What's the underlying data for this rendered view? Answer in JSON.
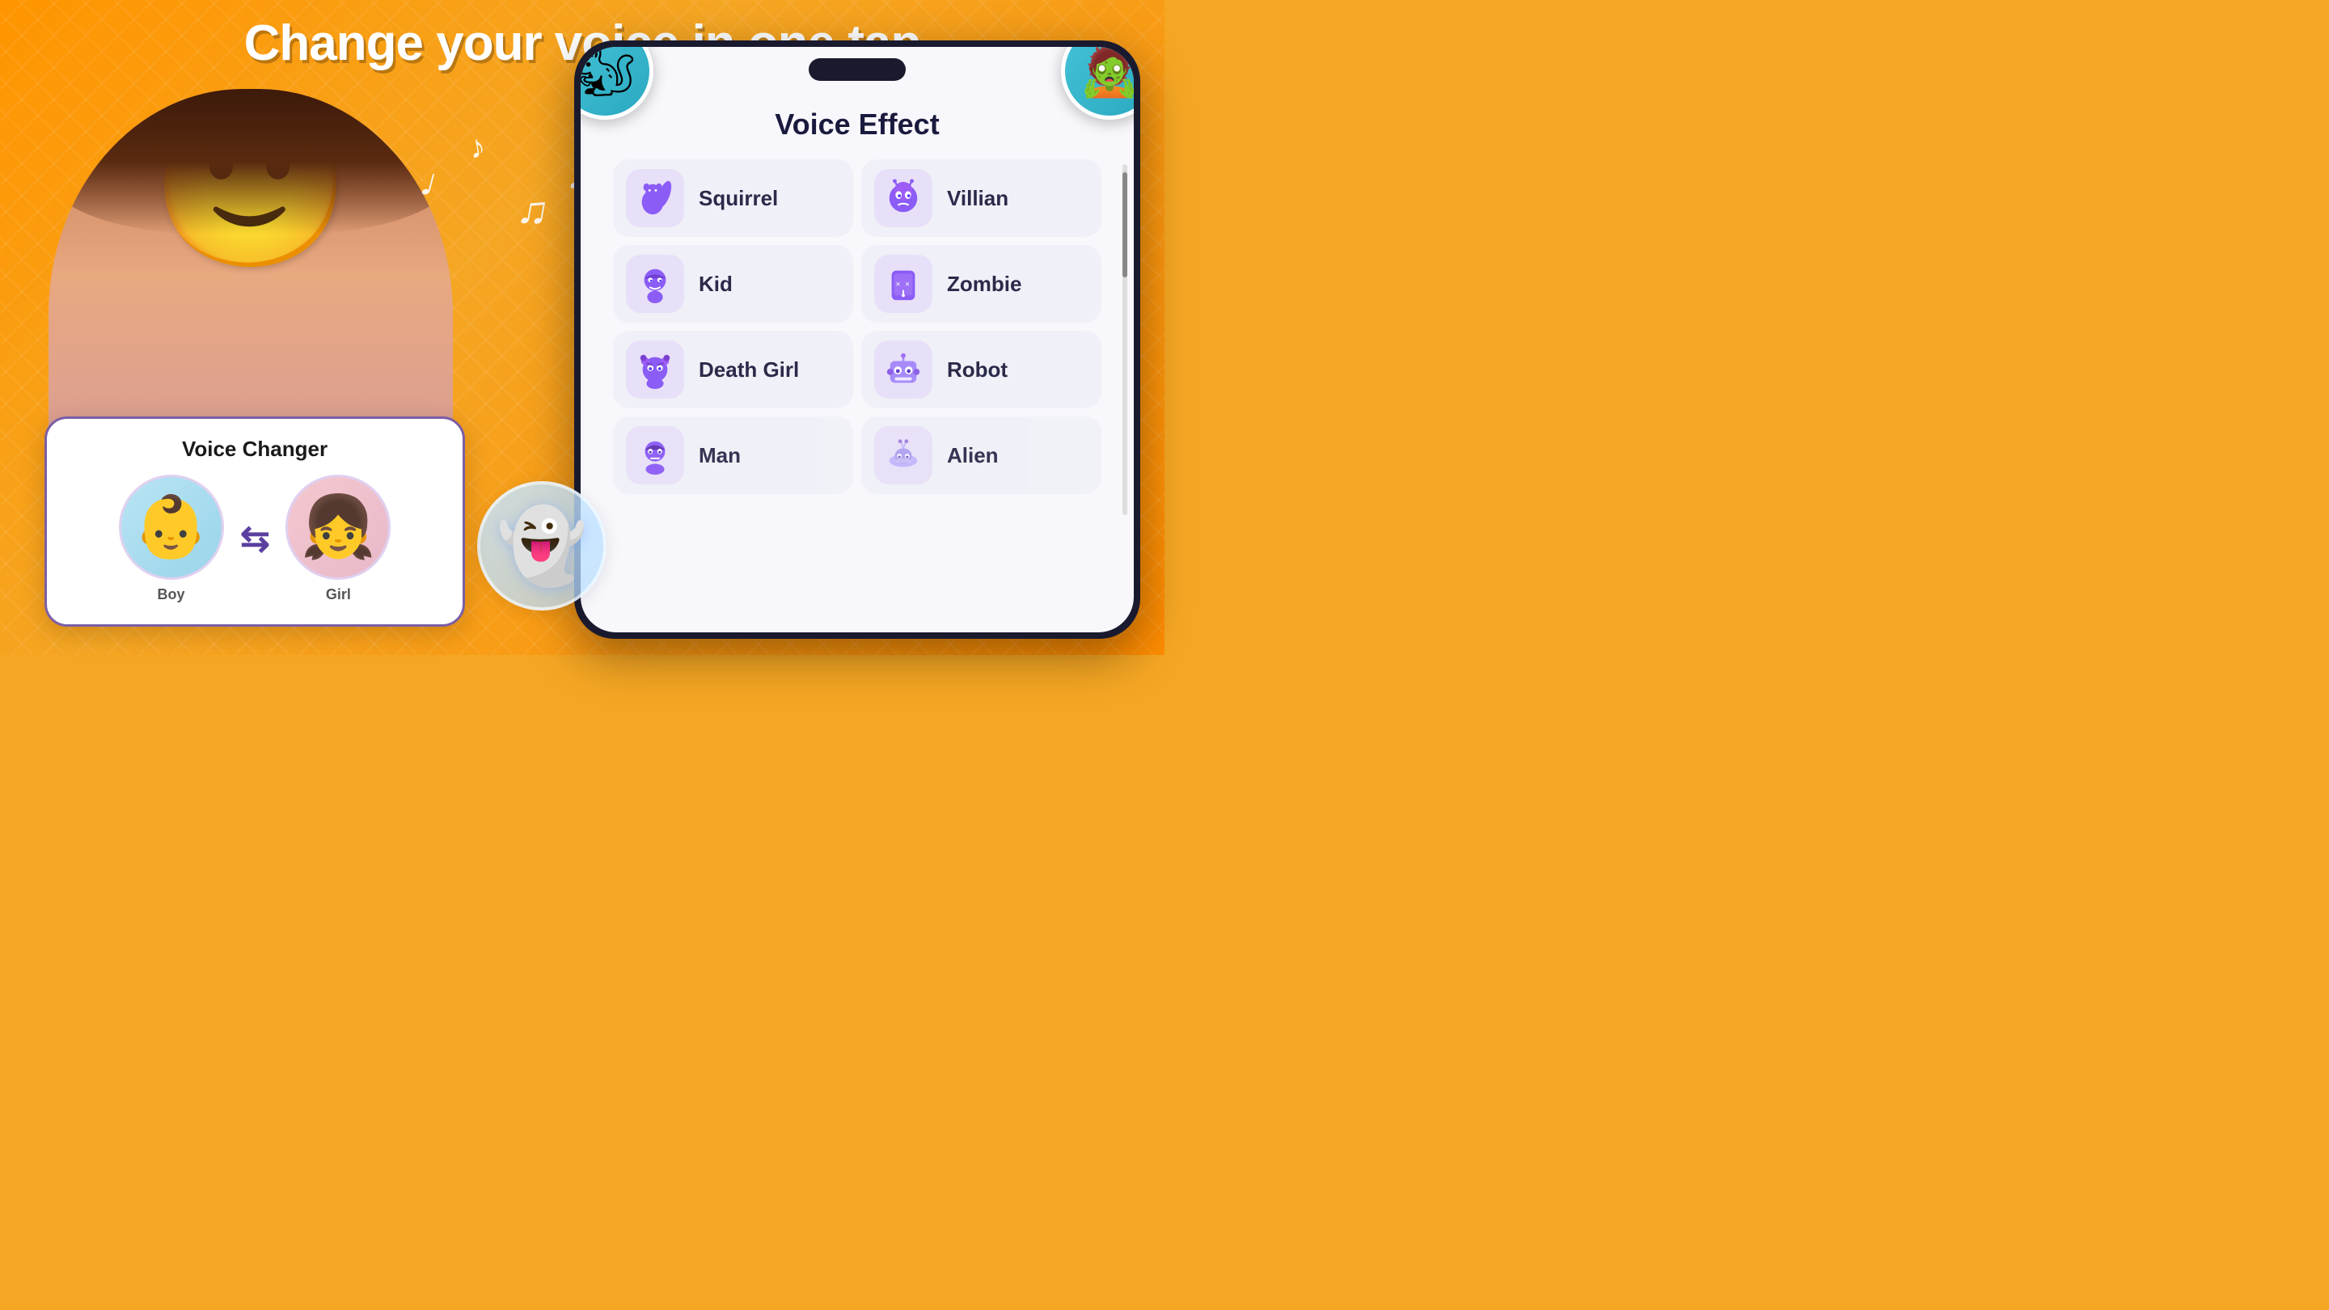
{
  "headline": "Change your voice in one tap",
  "colors": {
    "orange": "#F5A623",
    "purple": "#7B5EA7",
    "white": "#FFFFFF",
    "dark": "#1a1a2e"
  },
  "voiceChanger": {
    "title": "Voice Changer",
    "boy_label": "Boy",
    "girl_label": "Girl",
    "arrow": "↩"
  },
  "voiceEffect": {
    "title": "Voice Effect",
    "effects": [
      {
        "id": "squirrel",
        "name": "Squirrel",
        "emoji": "🐿"
      },
      {
        "id": "villain",
        "name": "Villian",
        "emoji": "💀"
      },
      {
        "id": "kid",
        "name": "Kid",
        "emoji": "👦"
      },
      {
        "id": "zombie",
        "name": "Zombie",
        "emoji": "🧟"
      },
      {
        "id": "deathgirl",
        "name": "Death Girl",
        "emoji": "💀"
      },
      {
        "id": "robot",
        "name": "Robot",
        "emoji": "🤖"
      },
      {
        "id": "man",
        "name": "Man",
        "emoji": "🧑"
      },
      {
        "id": "alien",
        "name": "Alien",
        "emoji": "👽"
      }
    ]
  },
  "floatingAvatars": {
    "squirrel_emoji": "🐿",
    "zombie_emoji": "🧟",
    "ghost_emoji": "👻"
  },
  "musicNotes": "♪ ♫"
}
